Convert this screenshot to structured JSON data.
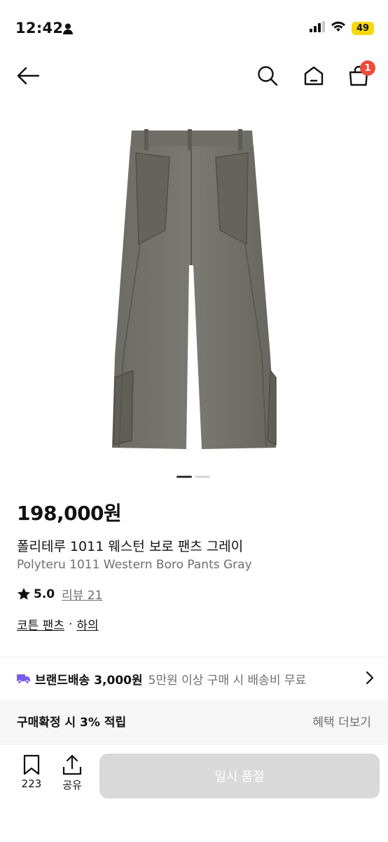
{
  "status_bar": {
    "time": "12:42",
    "battery": "49"
  },
  "nav": {
    "cart_count": "1"
  },
  "product": {
    "price": "198,000원",
    "name_ko": "폴리테루 1011 웨스턴 보로 팬츠 그레이",
    "name_en": "Polyteru 1011 Western Boro Pants Gray",
    "rating": "5.0",
    "review_label": "리뷰 21",
    "category_primary": "코튼 팬츠",
    "category_separator": "·",
    "category_secondary": "하의"
  },
  "delivery": {
    "label": "브랜드배송",
    "fee": "3,000원",
    "condition": "5만원 이상 구매 시 배송비 무료"
  },
  "points": {
    "label": "구매확정 시 3% 적립",
    "more": "혜택 더보기"
  },
  "bottom_bar": {
    "bookmark_count": "223",
    "share_label": "공유",
    "purchase_label": "일시 품절"
  },
  "colors": {
    "badge": "#ef4b3c",
    "delivery_truck": "#7b5cf0",
    "soldout_button": "#d9d9d9"
  }
}
